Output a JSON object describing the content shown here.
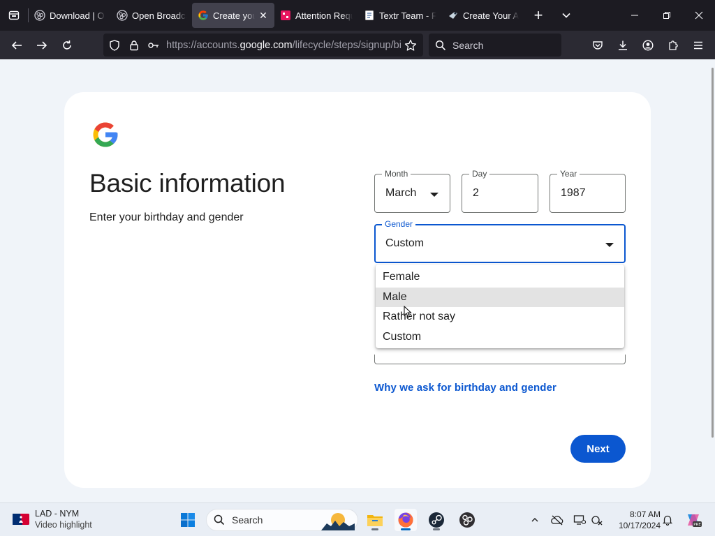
{
  "browser": {
    "tabs": [
      {
        "label": "Download | OBS",
        "icon": "obs-icon",
        "active": false
      },
      {
        "label": "Open Broadcaster",
        "icon": "obs-icon",
        "active": false
      },
      {
        "label": "Create your Google Account",
        "icon": "google-icon",
        "active": true
      },
      {
        "label": "Attention Required",
        "icon": "cloudflare-icon",
        "active": false
      },
      {
        "label": "Textr Team - Free",
        "icon": "document-icon",
        "active": false
      },
      {
        "label": "Create Your Account",
        "icon": "steam-icon",
        "active": false
      }
    ],
    "url_prefix": "https://accounts.",
    "url_host": "google.com",
    "url_path": "/lifecycle/steps/signup/birthdaygender",
    "search_placeholder": "Search"
  },
  "page": {
    "title": "Basic information",
    "subtitle": "Enter your birthday and gender",
    "month": {
      "label": "Month",
      "value": "March"
    },
    "day": {
      "label": "Day",
      "value": "2"
    },
    "year": {
      "label": "Year",
      "value": "1987"
    },
    "gender": {
      "label": "Gender",
      "value": "Custom",
      "options": [
        "Female",
        "Male",
        "Rather not say",
        "Custom"
      ],
      "hovered_option": "Male"
    },
    "why_link": "Why we ask for birthday and gender",
    "next_label": "Next",
    "accent_color": "#0b57d0"
  },
  "taskbar": {
    "news_title": "LAD - NYM",
    "news_subtitle": "Video highlight",
    "search_placeholder": "Search",
    "time": "8:07 AM",
    "date": "10/17/2024"
  }
}
